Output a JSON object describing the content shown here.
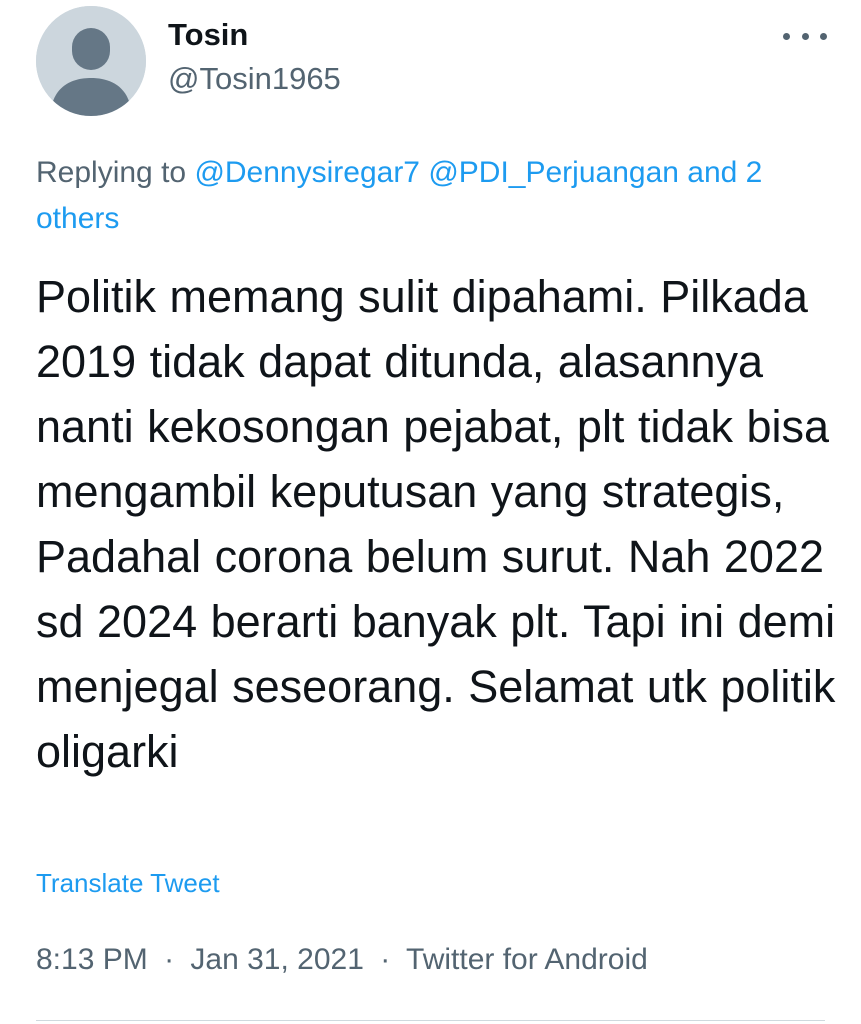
{
  "author": {
    "display_name": "Tosin",
    "handle": "@Tosin1965",
    "avatar_icon": "default-profile-avatar-icon"
  },
  "menu": {
    "icon": "more-options-icon"
  },
  "reply": {
    "prefix": "Replying to",
    "mentions": [
      "@Dennysiregar7",
      "@PDI_Perjuangan"
    ],
    "others": "and 2 others"
  },
  "tweet": {
    "text": "Politik memang sulit dipahami. Pilkada 2019 tidak dapat ditunda, alasannya nanti kekosongan pejabat, plt tidak bisa mengambil keputusan yang strategis,  Padahal corona belum surut. Nah 2022 sd 2024 berarti banyak plt. Tapi ini demi menjegal seseorang. Selamat utk politik oligarki",
    "translate_label": "Translate Tweet",
    "time": "8:13 PM",
    "date": "Jan 31, 2021",
    "source": "Twitter for Android",
    "separator": "·"
  },
  "colors": {
    "link": "#1d9bf0",
    "secondary_text": "#536471",
    "primary_text": "#0f1419",
    "avatar_bg": "#ccd6dd",
    "avatar_figure": "#657786"
  }
}
